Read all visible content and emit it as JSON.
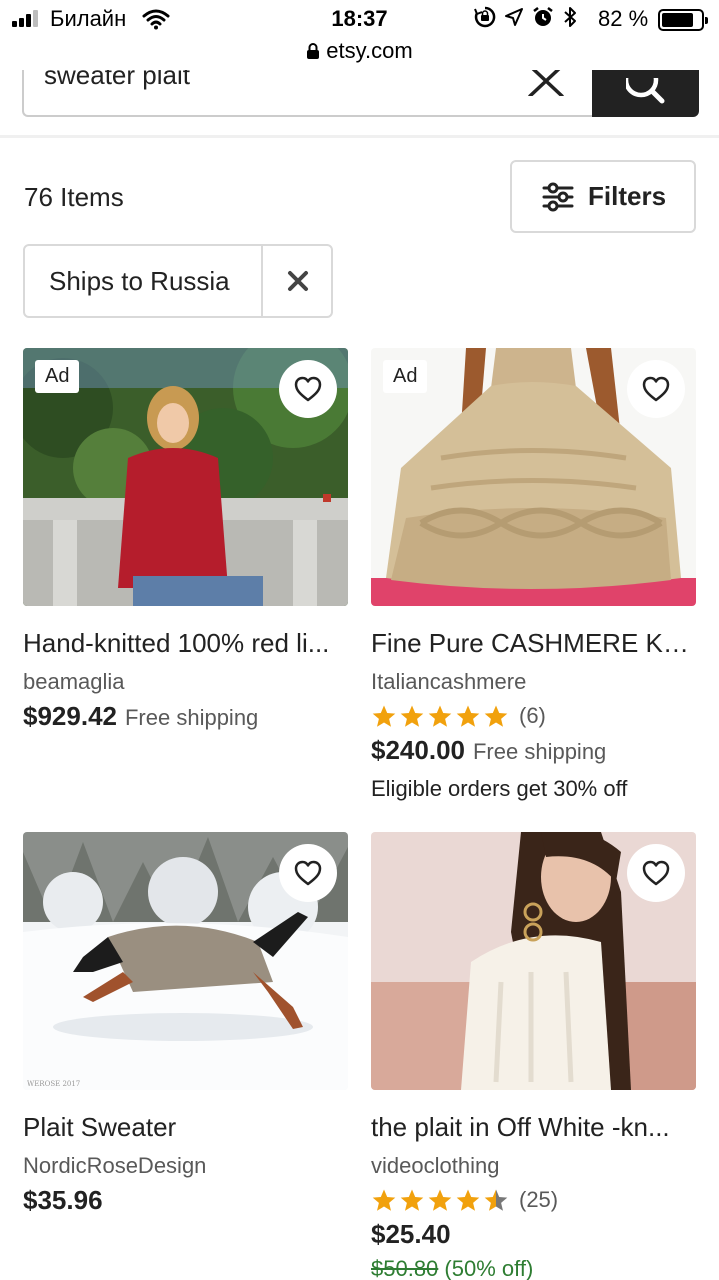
{
  "status_bar": {
    "carrier": "Билайн",
    "time": "18:37",
    "battery": "82 %",
    "battery_level": 0.82
  },
  "url_bar": {
    "domain": "etsy.com"
  },
  "search": {
    "query": "sweater plait"
  },
  "results": {
    "count_label": "76 Items",
    "filters_label": "Filters",
    "chip_label": "Ships to Russia"
  },
  "listings": [
    {
      "title": "Hand-knitted 100% red li...",
      "shop": "beamaglia",
      "price": "$929.42",
      "shipping": "Free shipping",
      "ad": "Ad"
    },
    {
      "title": "Fine Pure CASHMERE Kn...",
      "shop": "Italiancashmere",
      "rating": 5,
      "reviews": "(6)",
      "price": "$240.00",
      "shipping": "Free shipping",
      "promo": "Eligible orders get 30% off",
      "ad": "Ad"
    },
    {
      "title": "Plait Sweater",
      "shop": "NordicRoseDesign",
      "price": "$35.96"
    },
    {
      "title": "the plait in Off White -kn...",
      "shop": "videoclothing",
      "rating": 4.5,
      "reviews": "(25)",
      "price": "$25.40",
      "original_price": "$50.80",
      "discount": "(50% off)"
    }
  ],
  "colors": {
    "star": "#F1A10D",
    "dark": "#222222",
    "discount": "#2E7D32"
  }
}
